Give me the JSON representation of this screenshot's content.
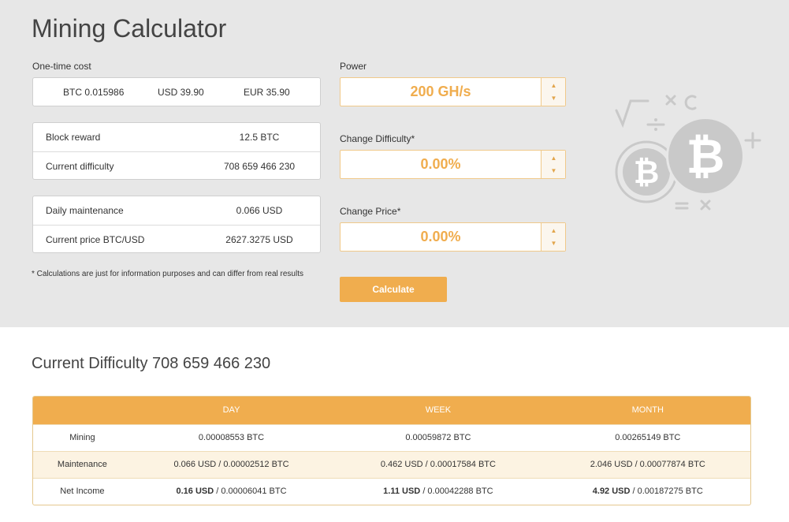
{
  "page": {
    "title": "Mining Calculator"
  },
  "one_time_cost": {
    "label": "One-time cost",
    "btc": "BTC 0.015986",
    "usd": "USD 39.90",
    "eur": "EUR 35.90"
  },
  "block_info": [
    {
      "label": "Block reward",
      "value": "12.5 BTC"
    },
    {
      "label": "Current difficulty",
      "value": "708 659 466 230"
    }
  ],
  "maintenance_info": [
    {
      "label": "Daily maintenance",
      "value": "0.066 USD"
    },
    {
      "label": "Current price BTC/USD",
      "value": "2627.3275 USD"
    }
  ],
  "note": "* Calculations are just for information purposes and can differ from real results",
  "power": {
    "label": "Power",
    "value": "200 GH/s"
  },
  "change_difficulty": {
    "label": "Change Difficulty*",
    "value": "0.00%"
  },
  "change_price": {
    "label": "Change Price*",
    "value": "0.00%"
  },
  "calculate_label": "Calculate",
  "icons": {
    "up": "▲",
    "down": "▼"
  },
  "colors": {
    "accent": "#f0ad4e",
    "panel_bg": "#e7e7e7"
  },
  "results": {
    "title": "Current Difficulty 708 659 466 230",
    "headers": [
      "",
      "DAY",
      "WEEK",
      "MONTH"
    ],
    "rows": [
      {
        "label": "Mining",
        "day": "0.00008553 BTC",
        "week": "0.00059872 BTC",
        "month": "0.00265149 BTC"
      },
      {
        "label": "Maintenance",
        "day": "0.066 USD / 0.00002512 BTC",
        "week": "0.462 USD / 0.00017584 BTC",
        "month": "2.046 USD / 0.00077874 BTC"
      },
      {
        "label": "Net Income",
        "day_usd": "0.16 USD",
        "day_btc": " / 0.00006041 BTC",
        "week_usd": "1.11 USD",
        "week_btc": " / 0.00042288 BTC",
        "month_usd": "4.92 USD",
        "month_btc": " / 0.00187275 BTC"
      }
    ]
  }
}
